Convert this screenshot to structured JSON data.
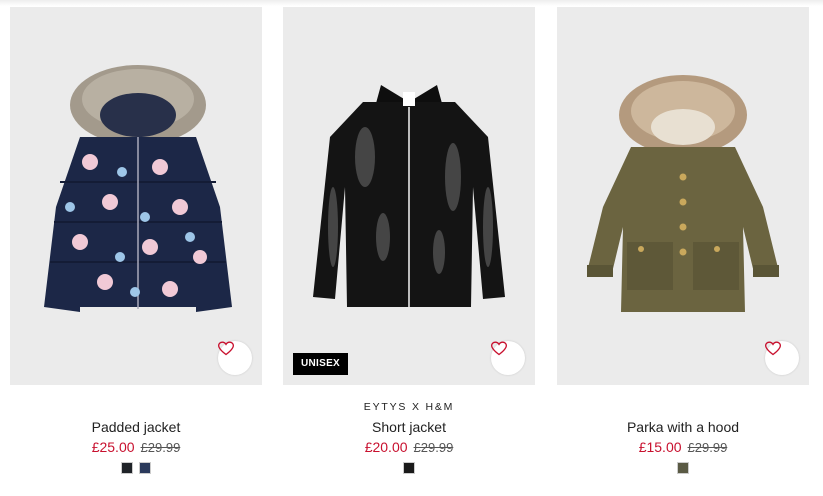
{
  "products": [
    {
      "brand": "",
      "title": "Padded jacket",
      "price": "£25.00",
      "old_price": "£29.99",
      "badge": "",
      "swatches": [
        "#1f2328",
        "#2b3a5c"
      ],
      "image_alt": "padded-jacket-image"
    },
    {
      "brand": "EYTYS X H&M",
      "title": "Short jacket",
      "price": "£20.00",
      "old_price": "£29.99",
      "badge": "UNISEX",
      "swatches": [
        "#1a1a1a"
      ],
      "image_alt": "short-jacket-image"
    },
    {
      "brand": "",
      "title": "Parka with a hood",
      "price": "£15.00",
      "old_price": "£29.99",
      "badge": "",
      "swatches": [
        "#5a5a44"
      ],
      "image_alt": "parka-image"
    }
  ],
  "colors": {
    "sale_price": "#c8102e",
    "favourite_icon": "#c8102e",
    "tile_background": "#ebebeb"
  },
  "icons": {
    "favourite": "heart-outline-icon"
  }
}
